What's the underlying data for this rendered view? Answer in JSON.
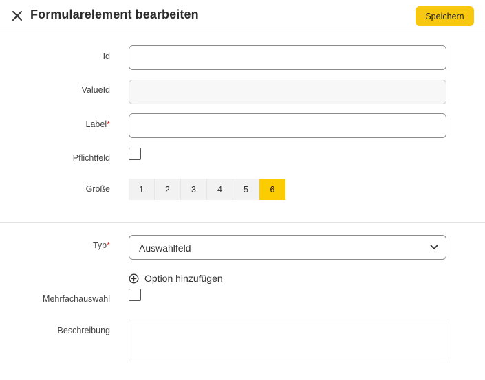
{
  "header": {
    "title": "Formularelement bearbeiten",
    "close_icon": "close-icon",
    "save_label": "Speichern",
    "save_color": "#f8c811"
  },
  "fields": {
    "id": {
      "label": "Id",
      "value": ""
    },
    "value_id": {
      "label": "ValueId",
      "value": "",
      "disabled": true
    },
    "label": {
      "label": "Label",
      "required_mark": "*",
      "value": ""
    },
    "required": {
      "label": "Pflichtfeld",
      "checked": false
    },
    "size": {
      "label": "Größe",
      "options": [
        "1",
        "2",
        "3",
        "4",
        "5",
        "6"
      ],
      "selected": "6",
      "active_color": "#fccc02"
    },
    "type": {
      "label": "Typ",
      "required_mark": "*",
      "value": "Auswahlfeld",
      "icon": "chevron-down-icon"
    },
    "add_option": {
      "label": "Option hinzufügen",
      "icon": "plus-circle-icon"
    },
    "multi_select": {
      "label": "Mehrfachauswahl",
      "checked": false
    },
    "description": {
      "label": "Beschreibung",
      "value": ""
    }
  },
  "colors": {
    "required": "#d9342b",
    "divider": "#e3e3e3"
  }
}
